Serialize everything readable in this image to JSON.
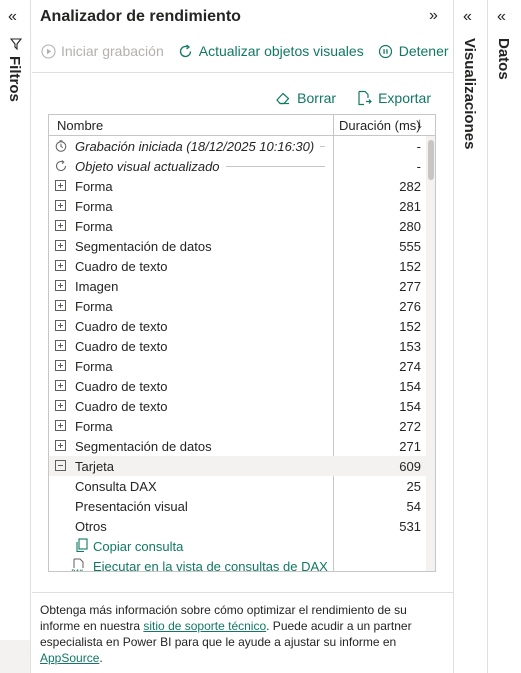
{
  "filters_rail": {
    "collapse_glyph": "«",
    "label": "Filtros"
  },
  "panel": {
    "title": "Analizador de rendimiento",
    "collapse_glyph": "»"
  },
  "toolbar": {
    "start_recording": "Iniciar grabación",
    "refresh_visuals": "Actualizar objetos visuales",
    "stop": "Detener"
  },
  "actions": {
    "clear": "Borrar",
    "export": "Exportar"
  },
  "table": {
    "columns": {
      "name": "Nombre",
      "duration": "Duración (ms)"
    },
    "rows": [
      {
        "label": "Grabación iniciada (18/12/2025 10:16:30)",
        "value": "-",
        "kind": "timer",
        "italic": true
      },
      {
        "label": "Objeto visual actualizado",
        "value": "-",
        "kind": "refresh",
        "italic": true
      },
      {
        "label": "Forma",
        "value": "282",
        "kind": "expand"
      },
      {
        "label": "Forma",
        "value": "281",
        "kind": "expand"
      },
      {
        "label": "Forma",
        "value": "280",
        "kind": "expand"
      },
      {
        "label": "Segmentación de datos",
        "value": "555",
        "kind": "expand"
      },
      {
        "label": "Cuadro de texto",
        "value": "152",
        "kind": "expand"
      },
      {
        "label": "Imagen",
        "value": "277",
        "kind": "expand"
      },
      {
        "label": "Forma",
        "value": "276",
        "kind": "expand"
      },
      {
        "label": "Cuadro de texto",
        "value": "152",
        "kind": "expand"
      },
      {
        "label": "Cuadro de texto",
        "value": "153",
        "kind": "expand"
      },
      {
        "label": "Forma",
        "value": "274",
        "kind": "expand"
      },
      {
        "label": "Cuadro de texto",
        "value": "154",
        "kind": "expand"
      },
      {
        "label": "Cuadro de texto",
        "value": "154",
        "kind": "expand"
      },
      {
        "label": "Forma",
        "value": "272",
        "kind": "expand"
      },
      {
        "label": "Segmentación de datos",
        "value": "271",
        "kind": "expand"
      },
      {
        "label": "Tarjeta",
        "value": "609",
        "kind": "collapse",
        "selected": true
      },
      {
        "label": "Consulta DAX",
        "value": "25",
        "kind": "child"
      },
      {
        "label": "Presentación visual",
        "value": "54",
        "kind": "child"
      },
      {
        "label": "Otros",
        "value": "531",
        "kind": "child"
      },
      {
        "label": "Copiar consulta",
        "value": "",
        "kind": "copy-link"
      },
      {
        "label": "Ejecutar en la vista de consultas de DAX",
        "value": "",
        "kind": "dax-link"
      }
    ]
  },
  "footer": {
    "text_1": "Obtenga más información sobre cómo optimizar el rendimiento de su informe en nuestra ",
    "link_1": "sitio de soporte técnico",
    "text_2": ". Puede acudir a un partner especialista en Power BI para que le ayude a ajustar su informe en ",
    "link_2": "AppSource",
    "text_3": "."
  },
  "visualizations_rail": {
    "collapse_glyph": "«",
    "label": "Visualizaciones"
  },
  "data_rail": {
    "collapse_glyph": "«",
    "label": "Datos"
  },
  "colors": {
    "accent": "#117865",
    "disabled": "#b3b0ad",
    "border": "#c8c6c4",
    "selected_row": "#f3f2f1"
  }
}
